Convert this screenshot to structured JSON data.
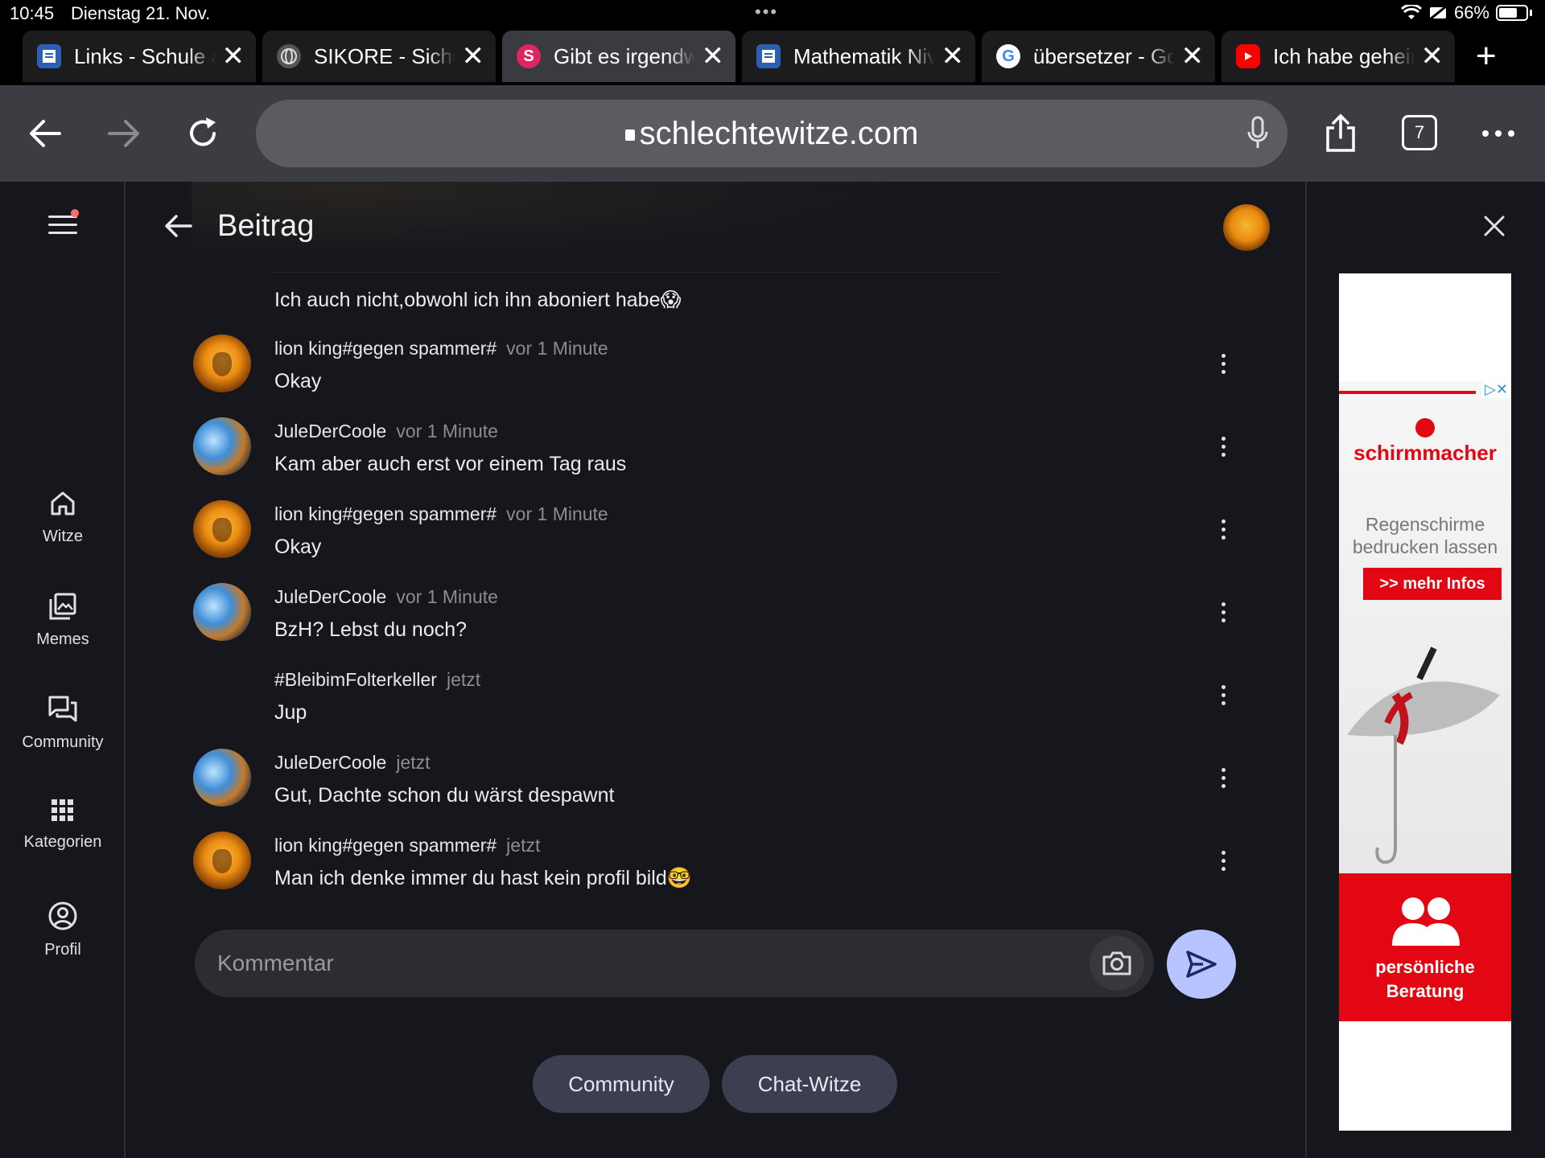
{
  "status": {
    "time": "10:45",
    "date": "Dienstag 21. Nov.",
    "battery": "66%"
  },
  "tabs": [
    {
      "title": "Links - Schule a",
      "active": false,
      "icon": "doc-icon"
    },
    {
      "title": "SIKORE - Siche",
      "active": false,
      "icon": "globe-icon"
    },
    {
      "title": "Gibt es irgendw",
      "active": true,
      "icon": "s-icon"
    },
    {
      "title": "Mathematik Niv",
      "active": false,
      "icon": "doc-icon"
    },
    {
      "title": "übersetzer - Go",
      "active": false,
      "icon": "google-icon"
    },
    {
      "title": "Ich habe geheir",
      "active": false,
      "icon": "youtube-icon"
    }
  ],
  "toolbar": {
    "url": "schlechtewitze.com",
    "tab_count": "7"
  },
  "sidebar": {
    "items": [
      {
        "label": "Witze",
        "icon": "home-icon"
      },
      {
        "label": "Memes",
        "icon": "gallery-icon"
      },
      {
        "label": "Community",
        "icon": "forum-icon"
      },
      {
        "label": "Kategorien",
        "icon": "grid-icon"
      },
      {
        "label": "Profil",
        "icon": "profile-icon"
      }
    ]
  },
  "header": {
    "title": "Beitrag"
  },
  "messages": [
    {
      "author": "",
      "time": "",
      "text": "Ich auch nicht,obwohl ich ihn aboniert habe😱",
      "avatar": "none"
    },
    {
      "author": "lion king#gegen spammer#",
      "time": "vor 1 Minute",
      "text": "Okay",
      "avatar": "lion"
    },
    {
      "author": "JuleDerCoole",
      "time": "vor 1 Minute",
      "text": "Kam aber auch erst vor einem Tag raus",
      "avatar": "jule"
    },
    {
      "author": "lion king#gegen spammer#",
      "time": "vor 1 Minute",
      "text": "Okay",
      "avatar": "lion"
    },
    {
      "author": "JuleDerCoole",
      "time": "vor 1 Minute",
      "text": "BzH? Lebst du noch?",
      "avatar": "jule"
    },
    {
      "author": "#BleibimFolterkeller",
      "time": "jetzt",
      "text": "Jup",
      "avatar": "none"
    },
    {
      "author": "JuleDerCoole",
      "time": "jetzt",
      "text": "Gut, Dachte schon du wärst despawnt",
      "avatar": "jule"
    },
    {
      "author": "lion king#gegen spammer#",
      "time": "jetzt",
      "text": "Man ich denke immer du hast kein profil bild🤓",
      "avatar": "lion"
    }
  ],
  "comment": {
    "placeholder": "Kommentar"
  },
  "pills": {
    "community": "Community",
    "chat_witze": "Chat-Witze"
  },
  "ad": {
    "brand": "schirmmacher",
    "line1": "Regenschirme",
    "line2": "bedrucken lassen",
    "cta": ">> mehr Infos",
    "bottom1": "persönliche",
    "bottom2": "Beratung",
    "accent": "#e30613"
  },
  "colors": {
    "page_bg": "#16171d",
    "send_button": "#b7c4ff",
    "pill_bg": "#3c3f4f"
  }
}
